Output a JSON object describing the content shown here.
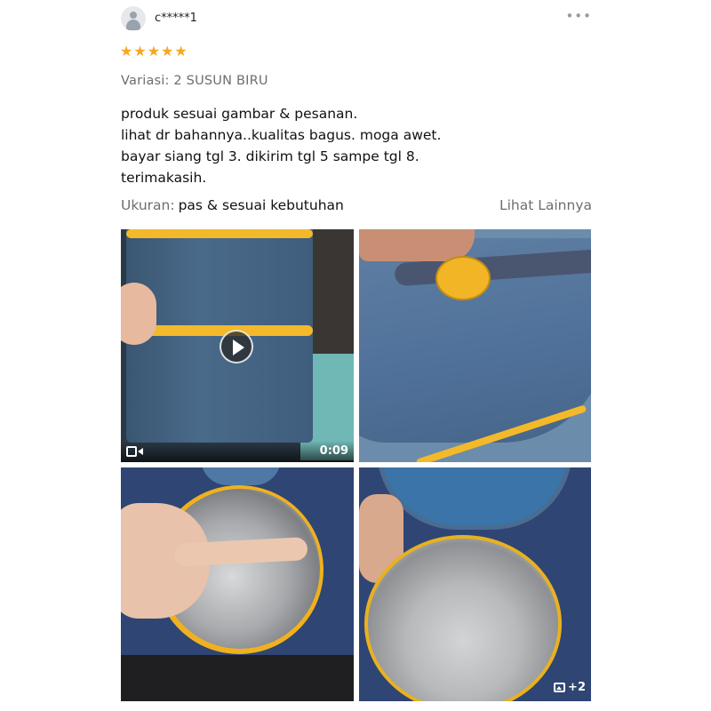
{
  "reviewer": {
    "name": "c*****1",
    "avatar_icon": "user-avatar-icon"
  },
  "menu_icon": "more-dots-icon",
  "rating": {
    "stars": 5,
    "max": 5,
    "star_glyph": "★",
    "color": "#f5a623"
  },
  "variant": "Variasi: 2 SUSUN BIRU",
  "review_lines": [
    "produk sesuai gambar & pesanan.",
    "lihat dr bahannya..kualitas bagus. moga awet.",
    "bayar siang tgl 3. dikirim tgl 5 sampe tgl 8.",
    "terimakasih."
  ],
  "size": {
    "label": "Ukuran:",
    "value": "pas & sesuai kebutuhan"
  },
  "see_more": "Lihat Lainnya",
  "media": {
    "video": {
      "duration": "0:09",
      "play_icon": "play-icon",
      "camera_icon": "video-camera-icon"
    },
    "photos_extra_count": "+2",
    "photos_icon": "image-icon"
  },
  "colors": {
    "accent_star": "#f5a623",
    "muted_text": "#6e6e6e"
  }
}
